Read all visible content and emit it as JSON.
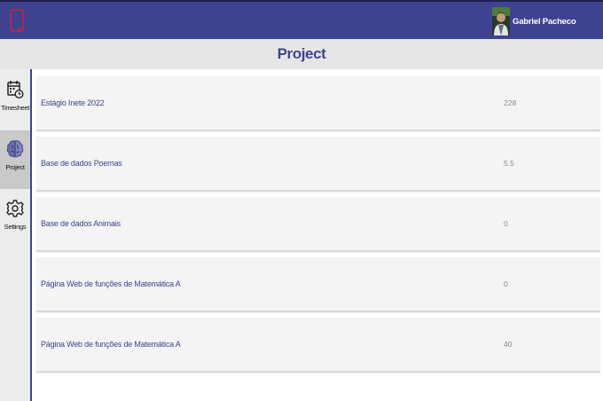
{
  "header": {
    "user_name": "Gabriel Pacheco",
    "brand_color": "#3e4391",
    "logo_icon": "red-outline-logo-icon"
  },
  "page": {
    "title": "Project"
  },
  "sidebar": {
    "items": [
      {
        "label": "Timesheet",
        "icon": "calendar-clock-icon",
        "active": false
      },
      {
        "label": "Project",
        "icon": "brain-icon",
        "active": true
      },
      {
        "label": "Settings",
        "icon": "gear-icon",
        "active": false
      }
    ]
  },
  "projects": [
    {
      "name": "Estágio Inete 2022",
      "value": "228"
    },
    {
      "name": "Base de dados Poemas",
      "value": "5.5"
    },
    {
      "name": "Base de dados Animais",
      "value": "0"
    },
    {
      "name": "Página Web de funções de Matemática A",
      "value": "0"
    },
    {
      "name": "Página Web de funções de Matemática A",
      "value": "40"
    }
  ]
}
